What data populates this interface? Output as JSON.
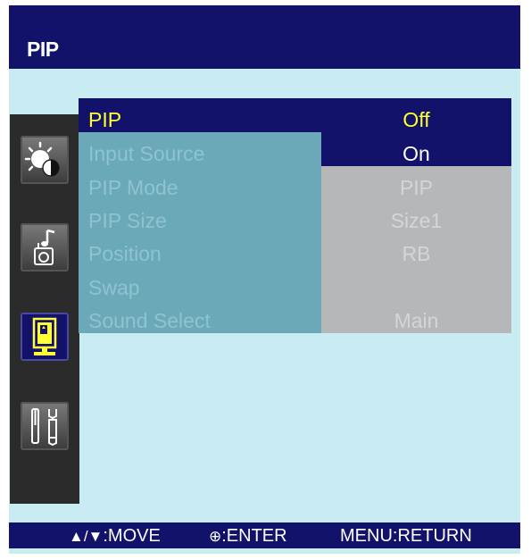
{
  "header": {
    "title": "PIP"
  },
  "sidebar": {
    "items": [
      {
        "name": "picture",
        "icon": "brightness-contrast-icon",
        "active": false
      },
      {
        "name": "sound",
        "icon": "music-note-icon",
        "active": false
      },
      {
        "name": "pip",
        "icon": "pip-monitor-icon",
        "active": true
      },
      {
        "name": "setup",
        "icon": "tools-icon",
        "active": false
      }
    ]
  },
  "menu": {
    "items": [
      {
        "label": "PIP",
        "value": "Off"
      },
      {
        "label": "Input Source",
        "value": "On"
      },
      {
        "label": "PIP Mode",
        "value": "PIP"
      },
      {
        "label": "PIP Size",
        "value": "Size1"
      },
      {
        "label": "Position",
        "value": "RB"
      },
      {
        "label": "Swap",
        "value": ""
      },
      {
        "label": "Sound Select",
        "value": "Main"
      }
    ]
  },
  "footer": {
    "move_glyph": "▲/▼",
    "move_label": ":MOVE",
    "enter_glyph": "⊕",
    "enter_label": ":ENTER",
    "return_label": "MENU:RETURN"
  },
  "colors": {
    "dark_blue": "#12126a",
    "background": "#c9ecf3",
    "highlight_yellow": "#ffff33",
    "disabled_label": "#8ec3cf",
    "value_panel": "#b5b7b9"
  }
}
